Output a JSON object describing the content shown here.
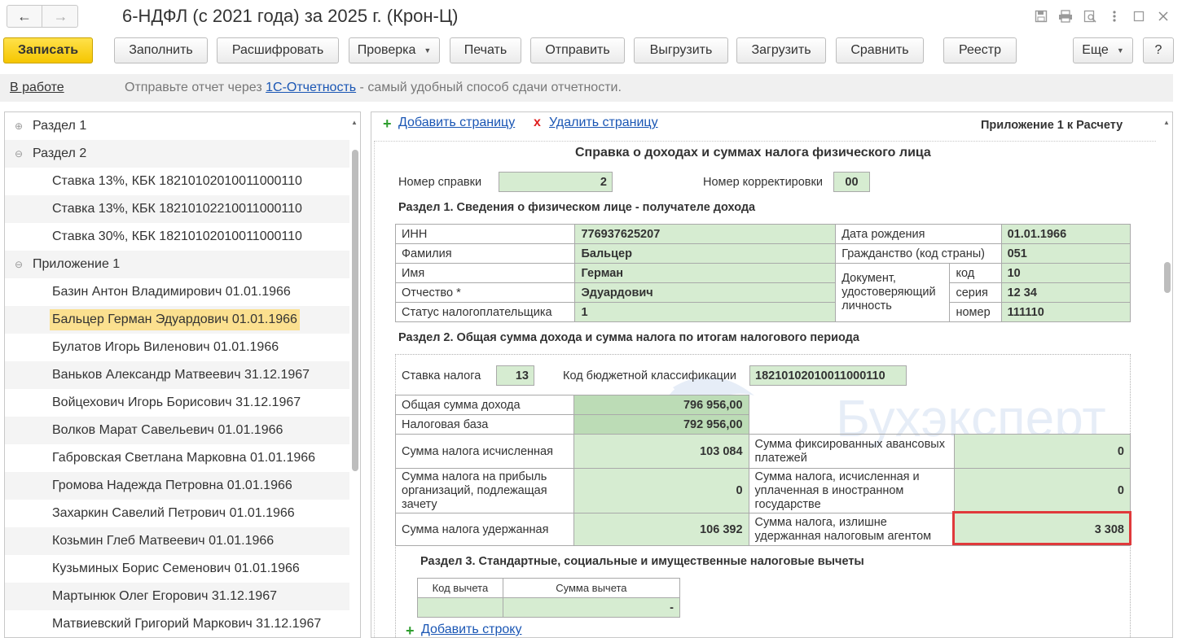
{
  "window": {
    "title": "6-НДФЛ (с 2021 года) за 2025 г. (Крон-Ц)",
    "back_icon": "←",
    "forward_icon": "→"
  },
  "toolbar": {
    "save": "Записать",
    "fill": "Заполнить",
    "decode": "Расшифровать",
    "check": "Проверка",
    "print": "Печать",
    "send": "Отправить",
    "export": "Выгрузить",
    "import": "Загрузить",
    "compare": "Сравнить",
    "registry": "Реестр",
    "more": "Еще",
    "help": "?"
  },
  "infobar": {
    "status": "В работе",
    "msg_before": "Отправьте отчет через ",
    "msg_link": "1С-Отчетность",
    "msg_after": " - самый удобный способ сдачи отчетности."
  },
  "tree": {
    "items": [
      {
        "label": "Раздел 1",
        "level": 0,
        "expander": "⊕"
      },
      {
        "label": "Раздел 2",
        "level": 0,
        "expander": "⊖"
      },
      {
        "label": "Ставка 13%, КБК 18210102010011000110",
        "level": 1
      },
      {
        "label": "Ставка 13%, КБК 18210102210011000110",
        "level": 1
      },
      {
        "label": "Ставка 30%, КБК 18210102010011000110",
        "level": 1
      },
      {
        "label": "Приложение 1",
        "level": 0,
        "expander": "⊖"
      },
      {
        "label": "Базин Антон Владимирович 01.01.1966",
        "level": 1
      },
      {
        "label": "Бальцер Герман Эдуардович 01.01.1966",
        "level": 1,
        "selected": true
      },
      {
        "label": "Булатов Игорь Виленович 01.01.1966",
        "level": 1
      },
      {
        "label": "Ваньков Александр Матвеевич 31.12.1967",
        "level": 1
      },
      {
        "label": "Войцехович Игорь Борисович 31.12.1967",
        "level": 1
      },
      {
        "label": "Волков Марат Савельевич 01.01.1966",
        "level": 1
      },
      {
        "label": "Габровская Светлана Марковна 01.01.1966",
        "level": 1
      },
      {
        "label": "Громова Надежда Петровна 01.01.1966",
        "level": 1
      },
      {
        "label": "Захаркин Савелий Петрович 01.01.1966",
        "level": 1
      },
      {
        "label": "Козьмин Глеб Матвеевич 01.01.1966",
        "level": 1
      },
      {
        "label": "Кузьминых Борис Семенович 01.01.1966",
        "level": 1
      },
      {
        "label": "Мартынюк Олег Егорович 31.12.1967",
        "level": 1
      },
      {
        "label": "Матвиевский Григорий Маркович 31.12.1967",
        "level": 1
      }
    ]
  },
  "form": {
    "add_page": "Добавить страницу",
    "delete_page": "Удалить страницу",
    "appendix": "Приложение 1 к Расчету",
    "title": "Справка о доходах и суммах налога физического лица",
    "cert_number_label": "Номер справки",
    "cert_number": "2",
    "correction_label": "Номер корректировки",
    "correction": "00",
    "section1": {
      "title": "Раздел 1. Сведения о физическом лице - получателе дохода",
      "inn_label": "ИНН",
      "inn": "776937625207",
      "surname_label": "Фамилия",
      "surname": "Бальцер",
      "name_label": "Имя",
      "name": "Герман",
      "patronymic_label": "Отчество *",
      "patronymic": "Эдуардович",
      "status_label": "Статус налогоплательщика",
      "status": "1",
      "birth_label": "Дата рождения",
      "birth": "01.01.1966",
      "citizenship_label": "Гражданство (код страны)",
      "citizenship": "051",
      "doc_label": "Документ, удостоверяющий личность",
      "doc_code_label": "код",
      "doc_code": "10",
      "doc_series_label": "серия",
      "doc_series": "12 34",
      "doc_number_label": "номер",
      "doc_number": "111110"
    },
    "section2": {
      "title": "Раздел 2. Общая сумма дохода и сумма налога по итогам налогового периода",
      "rate_label": "Ставка налога",
      "rate": "13",
      "kbk_label": "Код бюджетной классификации",
      "kbk": "18210102010011000110",
      "total_income_label": "Общая сумма дохода",
      "total_income": "796 956,00",
      "tax_base_label": "Налоговая база",
      "tax_base": "792 956,00",
      "tax_calc_label": "Сумма налога исчисленная",
      "tax_calc": "103 084",
      "fixed_adv_label": "Сумма фиксированных авансовых платежей",
      "fixed_adv": "0",
      "profit_tax_label": "Сумма налога на прибыль организаций, подлежащая зачету",
      "profit_tax": "0",
      "foreign_tax_label": "Сумма налога, исчисленная и уплаченная в иностранном государстве",
      "foreign_tax": "0",
      "tax_withheld_label": "Сумма налога удержанная",
      "tax_withheld": "106 392",
      "overwithheld_label": "Сумма налога, излишне удержанная налоговым агентом",
      "overwithheld": "3 308"
    },
    "section3": {
      "title": "Раздел 3. Стандартные, социальные и имущественные налоговые вычеты",
      "code_header": "Код вычета",
      "sum_header": "Сумма вычета",
      "row_sum": "-",
      "add_row": "Добавить строку"
    }
  },
  "watermark": "Бухэксперт",
  "colors": {
    "accent_yellow": "#f5c600",
    "field_green": "#d6ecd1",
    "link_blue": "#1a56b4",
    "highlight_red": "#e0393b",
    "selection": "#fbe08f"
  }
}
